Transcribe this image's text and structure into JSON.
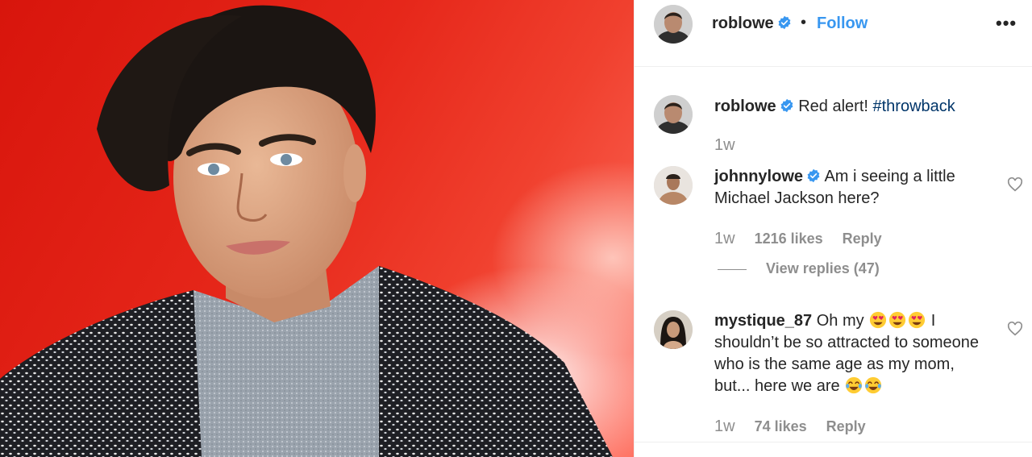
{
  "post": {
    "username": "roblowe",
    "follow_label": "Follow",
    "dot": "•",
    "more_label": "•••"
  },
  "caption": {
    "username": "roblowe",
    "text": "Red alert! ",
    "hashtag": "#throwback",
    "time": "1w"
  },
  "comments": [
    {
      "username": "johnnylowe",
      "text": "Am i seeing a little Michael Jackson here?",
      "time": "1w",
      "likes": "1216 likes",
      "reply": "Reply",
      "view_replies": "View replies (47)"
    },
    {
      "username": "mystique_87",
      "text_a": "Oh my",
      "text_b": "I shouldn’t be so attracted to someone who is the same age as my mom, but... here we are",
      "time": "1w",
      "likes": "74 likes",
      "reply": "Reply"
    }
  ],
  "colors": {
    "link_blue": "#3897f0",
    "hashtag": "#003569",
    "verified": "#3897f0",
    "muted": "#8e8e8e",
    "photo_red": "#e6271a"
  },
  "icons": {
    "verified": "verified-badge-icon",
    "heart": "heart-outline-icon",
    "more": "more-options-icon",
    "heart_eyes": "heart-eyes-emoji",
    "joy": "tears-of-joy-emoji"
  }
}
